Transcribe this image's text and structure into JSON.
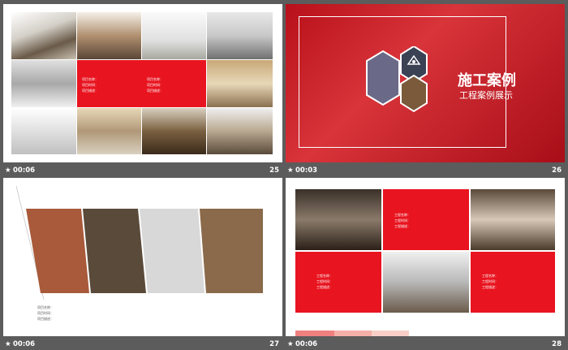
{
  "slides": [
    {
      "number": "25",
      "duration": "00:06",
      "captions": [
        [
          "项目名称：",
          "项目时间：",
          "项目描述："
        ],
        [
          "项目名称：",
          "项目时间：",
          "项目描述："
        ]
      ]
    },
    {
      "number": "26",
      "duration": "00:03",
      "title": "施工案例",
      "subtitle": "工程案例展示"
    },
    {
      "number": "27",
      "duration": "00:06",
      "captions": [
        "项目名称：",
        "项目时间：",
        "项目描述："
      ]
    },
    {
      "number": "28",
      "duration": "00:06",
      "captions": [
        [
          "工程名称：",
          "工程时间：",
          "工程描述："
        ],
        [
          "工程名称：",
          "工程时间：",
          "工程描述："
        ],
        [
          "工程名称：",
          "工程时间：",
          "工程描述："
        ]
      ]
    }
  ],
  "colors": {
    "accent": "#e8141f",
    "background": "#5c5c5c"
  },
  "icons": {
    "timing": "star-icon",
    "badge": "crane-icon"
  }
}
